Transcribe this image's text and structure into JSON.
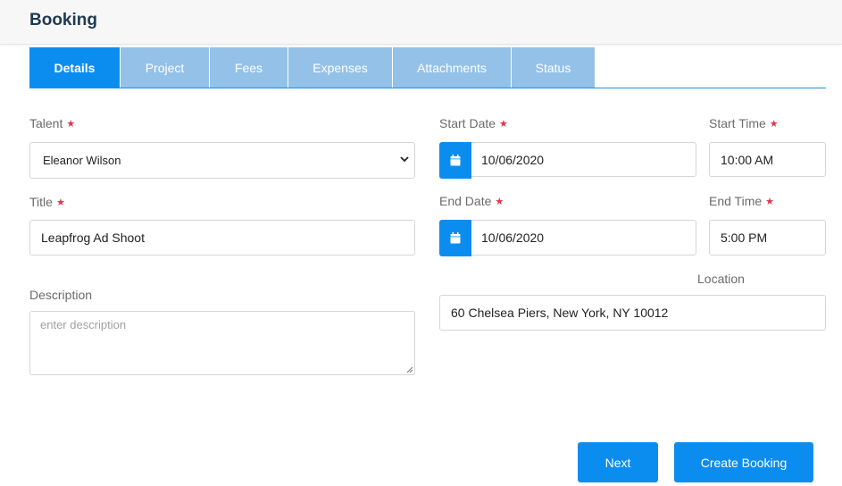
{
  "header": {
    "title": "Booking"
  },
  "tabs": [
    {
      "label": "Details",
      "active": true
    },
    {
      "label": "Project"
    },
    {
      "label": "Fees"
    },
    {
      "label": "Expenses"
    },
    {
      "label": "Attachments"
    },
    {
      "label": "Status"
    }
  ],
  "form": {
    "required_marker": "★",
    "talent": {
      "label": "Talent",
      "value": "Eleanor Wilson"
    },
    "title": {
      "label": "Title",
      "value": "Leapfrog Ad Shoot"
    },
    "description": {
      "label": "Description",
      "placeholder": "enter description",
      "value": ""
    },
    "start_date": {
      "label": "Start Date",
      "value": "10/06/2020"
    },
    "start_time": {
      "label": "Start Time",
      "value": "10:00 AM"
    },
    "end_date": {
      "label": "End Date",
      "value": "10/06/2020"
    },
    "end_time": {
      "label": "End Time",
      "value": "5:00 PM"
    },
    "location": {
      "label": "Location",
      "value": "60 Chelsea Piers, New York, NY 10012"
    }
  },
  "actions": {
    "next_label": "Next",
    "create_label": "Create Booking"
  },
  "colors": {
    "accent": "#0b8df0",
    "tab_inactive": "#94c1e8",
    "required": "#e2344a",
    "title": "#1d3a52"
  },
  "icons": {
    "date_picker": "calendar-icon",
    "dropdown": "chevron-down-icon"
  }
}
